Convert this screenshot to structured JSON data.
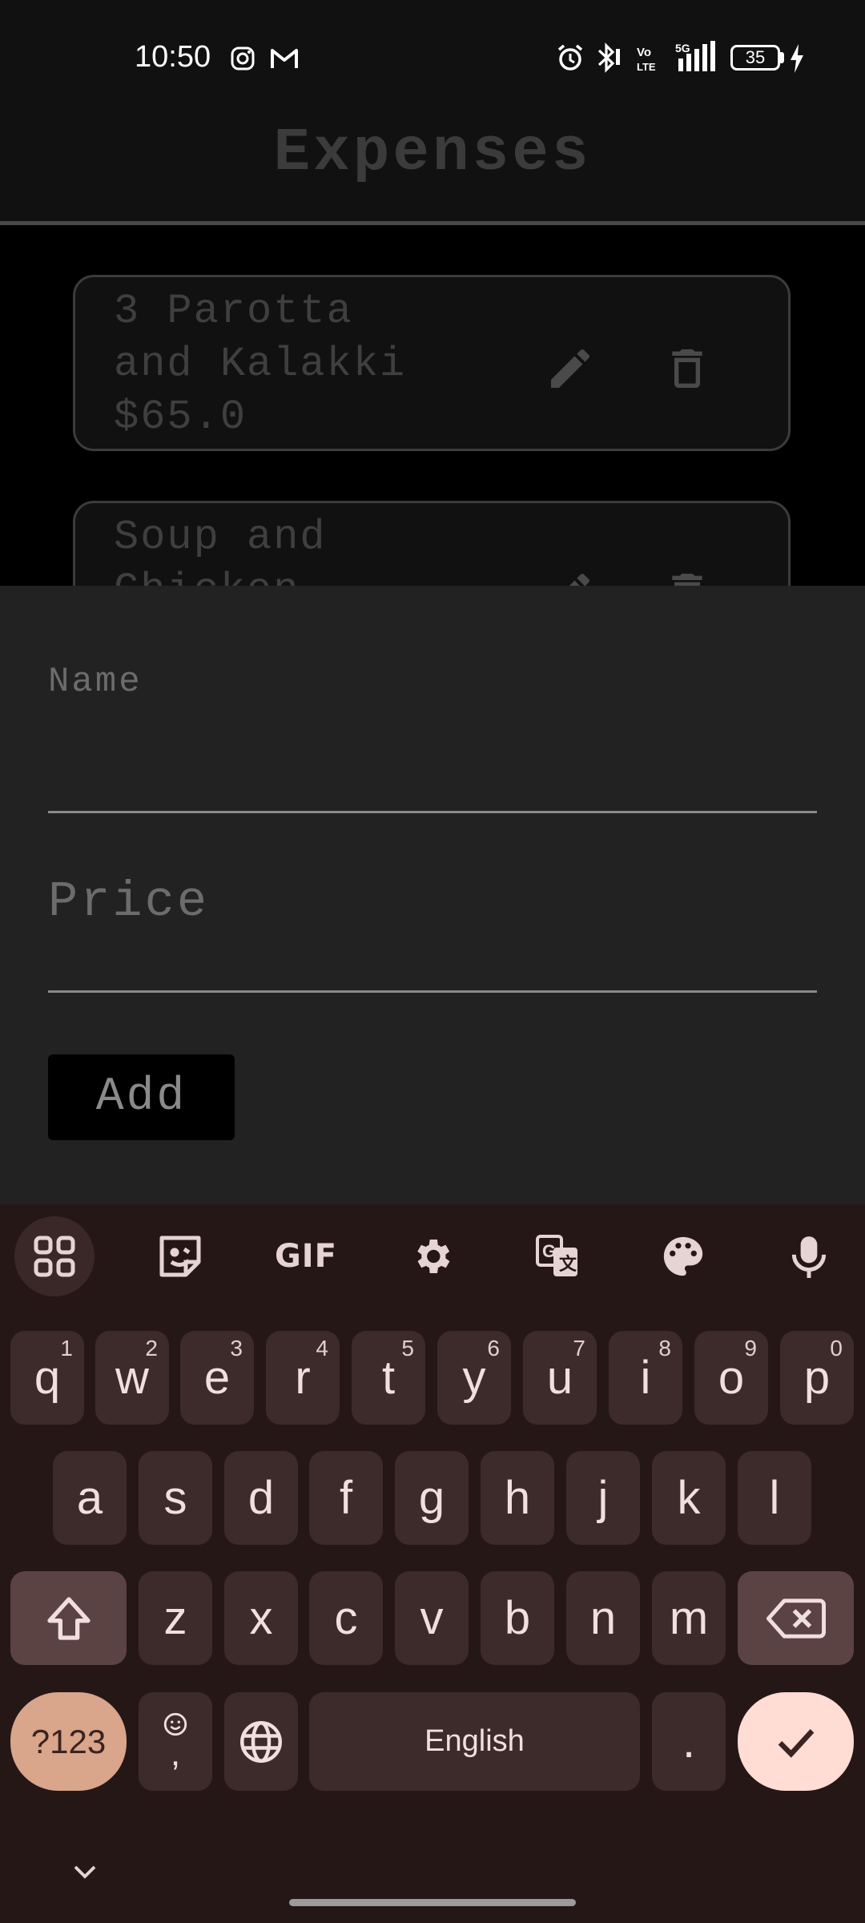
{
  "status": {
    "time": "10:50",
    "battery": "35",
    "icons_left": [
      "instagram-icon",
      "gmail-icon"
    ],
    "icons_right": [
      "alarm-icon",
      "bluetooth-icon",
      "volte-icon",
      "signal-5g-icon",
      "battery-icon",
      "charging-icon"
    ]
  },
  "app": {
    "title": "Expenses"
  },
  "expenses": [
    {
      "name_line1": "3 Parotta",
      "name_line2": "and Kalakki",
      "price": "$65.0"
    },
    {
      "name_line1": "Soup and",
      "name_line2": "Chicken"
    }
  ],
  "form": {
    "name_label": "Name",
    "price_label": "Price",
    "add_label": "Add"
  },
  "keyboard": {
    "row1": [
      {
        "k": "q",
        "h": "1"
      },
      {
        "k": "w",
        "h": "2"
      },
      {
        "k": "e",
        "h": "3"
      },
      {
        "k": "r",
        "h": "4"
      },
      {
        "k": "t",
        "h": "5"
      },
      {
        "k": "y",
        "h": "6"
      },
      {
        "k": "u",
        "h": "7"
      },
      {
        "k": "i",
        "h": "8"
      },
      {
        "k": "o",
        "h": "9"
      },
      {
        "k": "p",
        "h": "0"
      }
    ],
    "row2": [
      "a",
      "s",
      "d",
      "f",
      "g",
      "h",
      "j",
      "k",
      "l"
    ],
    "row3": [
      "z",
      "x",
      "c",
      "v",
      "b",
      "n",
      "m"
    ],
    "symbols_label": "?123",
    "comma_label": ",",
    "space_label": "English",
    "period_label": ".",
    "gif_label": "GIF",
    "colors": {
      "background": "#261717",
      "key": "#3d2b2b",
      "accent": "#d9a58b",
      "confirm": "#ffdcd4"
    }
  }
}
